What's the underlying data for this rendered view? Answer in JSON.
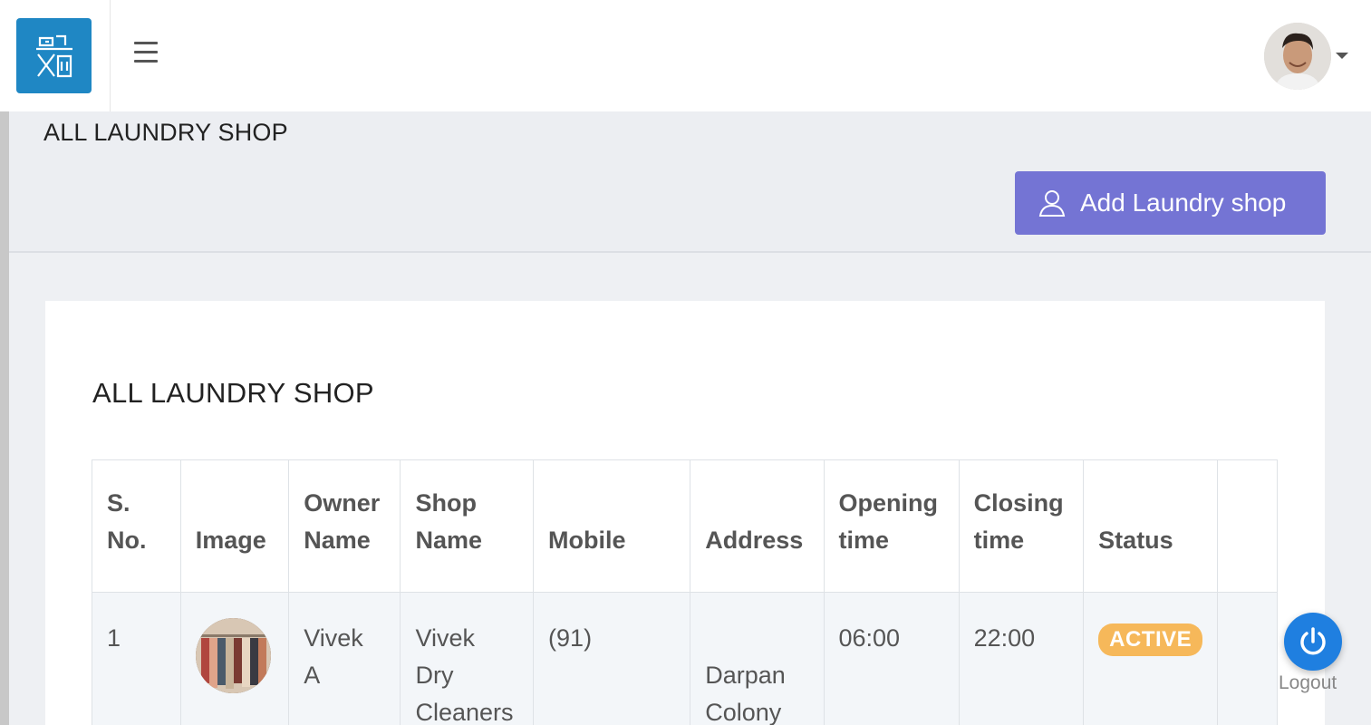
{
  "header": {
    "menu_icon": "hamburger-icon",
    "profile_icon": "chevron-down-icon"
  },
  "page": {
    "title": "ALL LAUNDRY SHOP",
    "add_button_label": "Add Laundry shop",
    "add_button_icon": "user-icon",
    "accent_color": "#7474d4"
  },
  "card": {
    "title": "ALL LAUNDRY SHOP"
  },
  "table": {
    "headers": {
      "sno": [
        "S.",
        "No."
      ],
      "image": [
        "Image"
      ],
      "owner": [
        "Owner",
        "Name"
      ],
      "shop": [
        "Shop",
        "Name"
      ],
      "mobile": [
        "Mobile"
      ],
      "address": [
        "Address"
      ],
      "opening": [
        "Opening",
        "time"
      ],
      "closing": [
        "Closing",
        "time"
      ],
      "status": [
        "Status"
      ]
    },
    "rows": [
      {
        "sno": "1",
        "owner": [
          "Vivek",
          "A"
        ],
        "shop": [
          "Vivek",
          "Dry",
          "Cleaners"
        ],
        "mobile": "(91)",
        "address": [
          "Darpan",
          "Colony"
        ],
        "opening": "06:00",
        "closing": "22:00",
        "status": "ACTIVE",
        "status_color": "#f6b85a"
      }
    ]
  },
  "logout": {
    "label": "Logout",
    "icon": "power-icon",
    "color": "#1f7fe0"
  }
}
